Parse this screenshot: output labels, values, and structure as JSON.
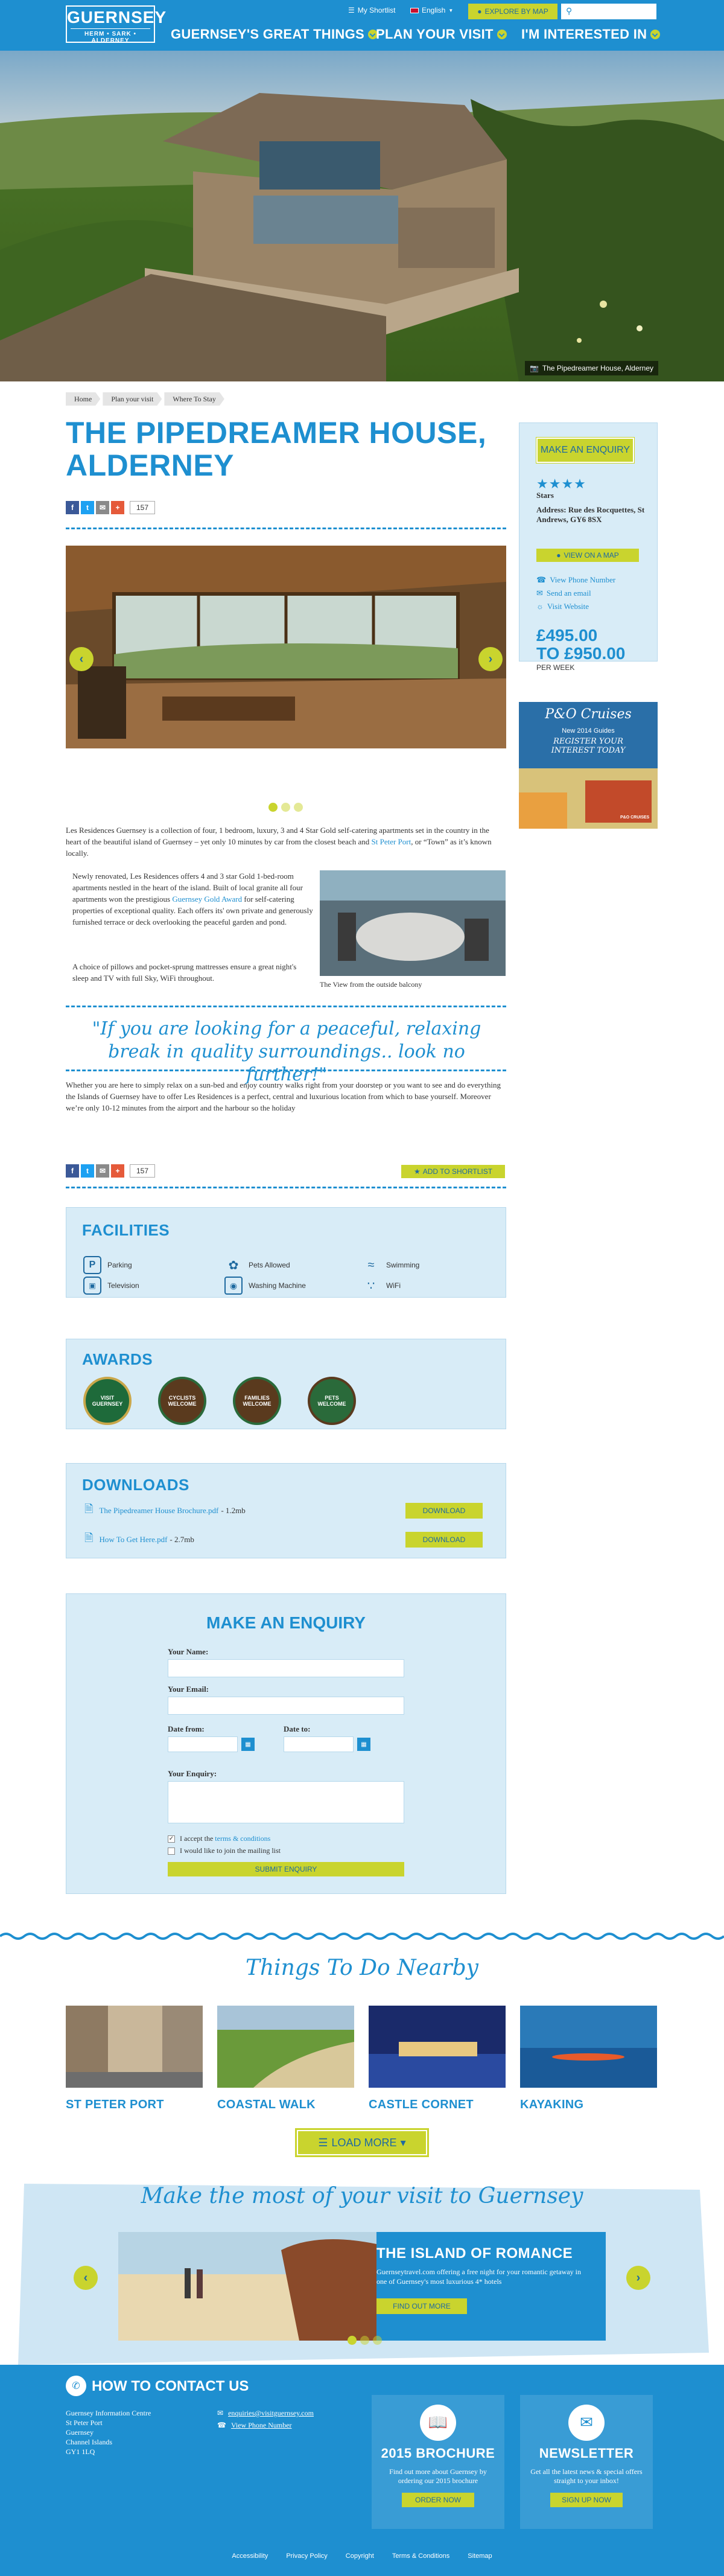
{
  "header": {
    "logo_main": "GUERNSEY",
    "logo_sub": "HERM • SARK • ALDERNEY",
    "shortlist": "My Shortlist",
    "language": "English",
    "explore": "EXPLORE BY MAP",
    "search_placeholder": "",
    "nav": [
      "GUERNSEY'S GREAT THINGS",
      "PLAN YOUR VISIT",
      "I'M INTERESTED IN"
    ]
  },
  "hero": {
    "caption": "The Pipedreamer House, Alderney"
  },
  "breadcrumb": [
    "Home",
    "Plan your visit",
    "Where To Stay"
  ],
  "title": "THE PIPEDREAMER HOUSE, ALDERNEY",
  "share_count": "157",
  "body": {
    "intro_a": "Les Residences Guernsey is a collection of four,  1 bedroom, luxury, 3 and 4 Star Gold self-catering apartments set in the country in the heart of the beautiful island of Guernsey – yet only 10 minutes by car from the closest beach and ",
    "intro_link": "St Peter Port",
    "intro_b": ", or “Town” as it’s known locally.",
    "para2_a": "Newly renovated, Les Residences offers 4 and 3 star Gold 1-bed-room apartments nestled in the heart of the island.  Built of local granite all four apartments won the  prestigious ",
    "para2_link": "Guernsey Gold Award",
    "para2_b": " for self-catering properties of exceptional quality. Each offers its' own private and generously furnished terrace or deck overlooking the peaceful garden and pond.",
    "para3": "A choice of pillows and pocket-sprung mattresses ensure a great night's sleep and TV with full Sky, WiFi throughout.",
    "image_caption": "The View from the outside balcony",
    "quote": "\"If you are looking for a peaceful, relaxing break in quality surroundings.. look no further!\"",
    "para4": "Whether you are here to simply relax on a sun-bed and enjoy country walks right from your doorstep or you want to see and do everything the Islands of Guernsey have to offer Les Residences is a perfect, central and luxurious location from which to base yourself. Moreover we’re only 10-12 minutes from the airport and the harbour so the holiday",
    "shortlist_btn": "ADD TO SHORTLIST"
  },
  "sidebar": {
    "enquiry_btn": "MAKE AN ENQUIRY",
    "stars_label": "Stars",
    "address": "Address: Rue des Rocquettes, St Andrews, GY6 8SX",
    "map_btn": "VIEW ON A MAP",
    "phone": "View Phone Number",
    "email": "Send an email",
    "website": "Visit Website",
    "price_from": "£495.00",
    "price_to": "TO £950.00",
    "per": "PER WEEK",
    "ad_title": "P&O Cruises",
    "ad_sub": "New 2014 Guides",
    "ad_cta": "REGISTER YOUR INTEREST TODAY",
    "ad_brand": "P&O CRUISES"
  },
  "facilities": {
    "title": "FACILITIES",
    "items": [
      "Parking",
      "Pets Allowed",
      "Swimming",
      "Television",
      "Washing Machine",
      "WiFi"
    ]
  },
  "awards": {
    "title": "AWARDS",
    "badges": [
      {
        "text": "VISIT GUERNSEY"
      },
      {
        "text": "CYCLISTS WELCOME"
      },
      {
        "text": "FAMILIES WELCOME"
      },
      {
        "text": "PETS WELCOME"
      }
    ]
  },
  "downloads": {
    "title": "DOWNLOADS",
    "items": [
      {
        "name": "The Pipedreamer House Brochure.pdf",
        "size": "- 1.2mb"
      },
      {
        "name": "How To Get Here.pdf",
        "size": "- 2.7mb"
      }
    ],
    "button": "DOWNLOAD"
  },
  "form": {
    "title": "MAKE AN ENQUIRY",
    "name": "Your Name:",
    "email": "Your Email:",
    "date_from": "Date from:",
    "date_to": "Date to:",
    "enquiry": "Your Enquiry:",
    "terms_a": "I accept the ",
    "terms_link": "terms & conditions",
    "mailing": "I would like to join the mailing list",
    "submit": "SUBMIT ENQUIRY"
  },
  "things": {
    "title": "Things To Do Nearby",
    "items": [
      "ST PETER PORT",
      "COASTAL WALK",
      "CASTLE CORNET",
      "KAYAKING"
    ],
    "load_more": "LOAD MORE"
  },
  "promo": {
    "title": "Make the most of your visit to Guernsey",
    "heading": "THE ISLAND OF ROMANCE",
    "text": "Guernseytravel.com offering a free night for your romantic getaway in one of Guernsey's most luxurious 4* hotels",
    "button": "FIND OUT MORE"
  },
  "footer": {
    "contact_title": "HOW TO CONTACT US",
    "address": [
      "Guernsey Information Centre",
      "St Peter Port",
      "Guernsey",
      "Channel Islands",
      "GY1 1LQ"
    ],
    "email": "enquiries@visitguernsey.com",
    "phone": "View Phone Number",
    "brochure_title": "2015 BROCHURE",
    "brochure_text": "Find out more about Guernsey by ordering our 2015 brochure",
    "brochure_btn": "ORDER NOW",
    "news_title": "NEWSLETTER",
    "news_text": "Get all the latest news & special offers straight to your inbox!",
    "news_btn": "SIGN UP NOW",
    "links": [
      "Accessibility",
      "Privacy Policy",
      "Copyright",
      "Terms & Conditions",
      "Sitemap"
    ]
  },
  "colors": {
    "primary": "#1e8fd0",
    "accent": "#c9d42e"
  }
}
